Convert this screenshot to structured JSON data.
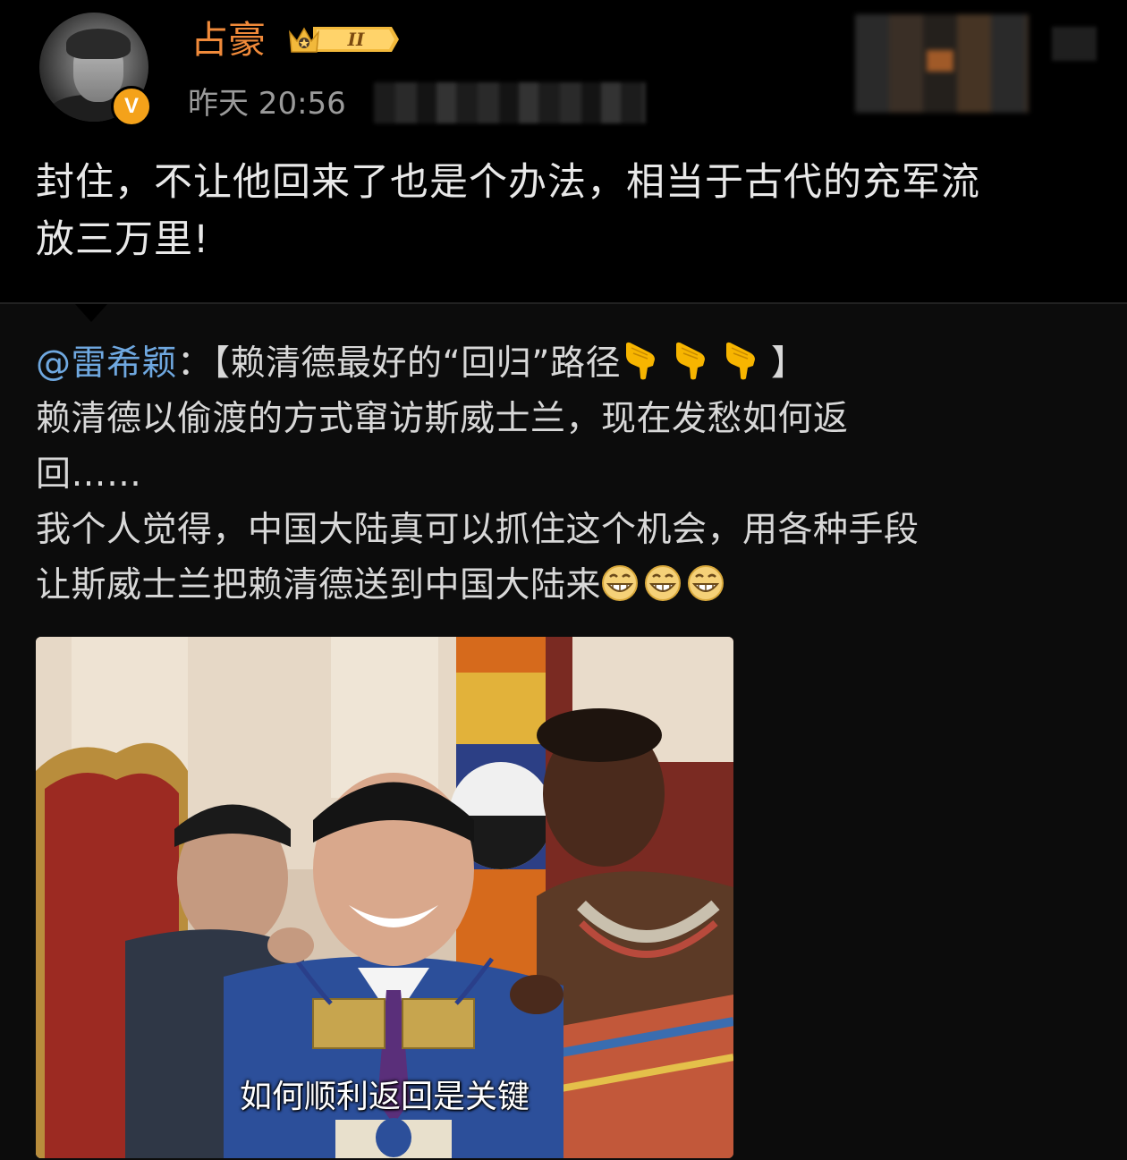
{
  "post": {
    "author": {
      "name": "占豪",
      "verified_badge": "V",
      "vip_level": "II"
    },
    "time": "昨天 20:56",
    "text_line1": "封住，不让他回来了也是个办法，相当于古代的充军流",
    "text_line2": "放三万里!"
  },
  "repost": {
    "mention": "@雷希颖",
    "colon": "：",
    "title": "【赖清德最好的“回归”路径",
    "title_end": "】",
    "line2": "赖清德以偷渡的方式窜访斯威士兰，现在发愁如何返",
    "line3": "回……",
    "line4": "我个人觉得，中国大陆真可以抓住这个机会，用各种手段",
    "line5": "让斯威士兰把赖清德送到中国大陆来",
    "image_caption": "如何顺利返回是关键",
    "emojis": {
      "point_down": "point-down-emoji",
      "grin": "grin-emoji"
    }
  },
  "colors": {
    "username": "#f08a3a",
    "mention": "#6fa8e0",
    "verified": "#f4a21a",
    "background": "#000000"
  }
}
